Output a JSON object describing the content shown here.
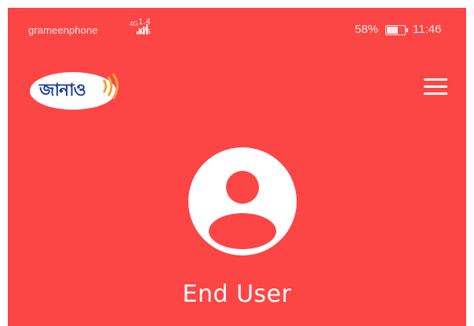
{
  "status_bar": {
    "carrier": "grameenphone",
    "network_type": "4G",
    "speed_value": "1.4",
    "speed_unit": "K/s",
    "battery_percent": "58%",
    "time": "11:46",
    "icons": [
      "signal-icon",
      "battery-icon"
    ]
  },
  "app_bar": {
    "logo_text": "জানাও",
    "menu_icon": "hamburger-menu-icon"
  },
  "profile": {
    "avatar_icon": "user-avatar-icon",
    "name": "End User"
  },
  "colors": {
    "background": "#fc4545",
    "foreground": "#ffffff",
    "logo_text": "#1a3f9e"
  }
}
